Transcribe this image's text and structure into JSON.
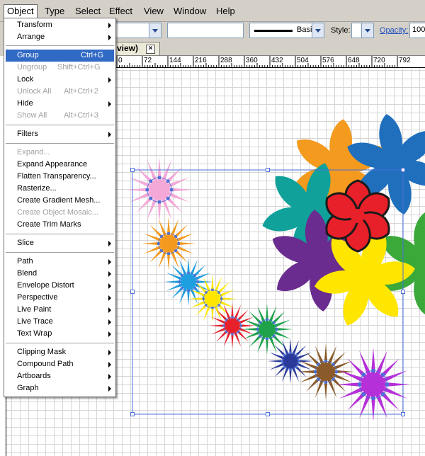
{
  "menubar": {
    "items": [
      "Object",
      "Type",
      "Select",
      "Effect",
      "View",
      "Window",
      "Help"
    ]
  },
  "control_bar": {
    "brush": "Basic",
    "style_label": "Style:",
    "opacity_label": "Opacity:",
    "opacity_value": "100"
  },
  "document_tab": {
    "label": "view)",
    "close": "×"
  },
  "ruler": {
    "ticks": [
      "0",
      "72",
      "144",
      "216",
      "288",
      "360",
      "432",
      "504",
      "576",
      "648",
      "720",
      "792"
    ]
  },
  "object_menu": {
    "transform": "Transform",
    "arrange": "Arrange",
    "group": "Group",
    "group_sc": "Ctrl+G",
    "ungroup": "Ungroup",
    "ungroup_sc": "Shift+Ctrl+G",
    "lock": "Lock",
    "unlock_all": "Unlock All",
    "unlock_all_sc": "Alt+Ctrl+2",
    "hide": "Hide",
    "show_all": "Show All",
    "show_all_sc": "Alt+Ctrl+3",
    "filters": "Filters",
    "expand": "Expand...",
    "expand_appearance": "Expand Appearance",
    "flatten_transparency": "Flatten Transparency...",
    "rasterize": "Rasterize...",
    "create_gradient_mesh": "Create Gradient Mesh...",
    "create_object_mosaic": "Create Object Mosaic...",
    "create_trim_marks": "Create Trim Marks",
    "slice": "Slice",
    "path": "Path",
    "blend": "Blend",
    "envelope_distort": "Envelope Distort",
    "perspective": "Perspective",
    "live_paint": "Live Paint",
    "live_trace": "Live Trace",
    "text_wrap": "Text Wrap",
    "clipping_mask": "Clipping Mask",
    "compound_path": "Compound Path",
    "artboards": "Artboards",
    "graph": "Graph"
  },
  "colors": {
    "highlight": "#316ac5",
    "selection": "#4a6fd8",
    "menu_disabled": "#a0a0a0"
  },
  "artwork": {
    "big_flowers": [
      {
        "name": "orange-flower",
        "color": "#f39a1f"
      },
      {
        "name": "blue-flower",
        "color": "#1f6fbd"
      },
      {
        "name": "teal-flower",
        "color": "#0fa19a"
      },
      {
        "name": "purple-flower",
        "color": "#6a2c8f"
      },
      {
        "name": "yellow-flower",
        "color": "#ffe600"
      },
      {
        "name": "green-flower",
        "color": "#3aa93a"
      },
      {
        "name": "red-flower",
        "color": "#e8202a"
      }
    ],
    "starbursts": [
      {
        "name": "pink-starburst",
        "color": "#f4a8d8"
      },
      {
        "name": "orange-starburst",
        "color": "#f39a1f"
      },
      {
        "name": "cyan-starburst",
        "color": "#1f9fe0"
      },
      {
        "name": "yellow-starburst",
        "color": "#ffe600"
      },
      {
        "name": "red-starburst",
        "color": "#e8202a"
      },
      {
        "name": "green-starburst",
        "color": "#1ea24a"
      },
      {
        "name": "navy-starburst",
        "color": "#2a3a9a"
      },
      {
        "name": "brown-starburst",
        "color": "#8a5a2a"
      },
      {
        "name": "violet-starburst",
        "color": "#b530d8"
      }
    ]
  }
}
